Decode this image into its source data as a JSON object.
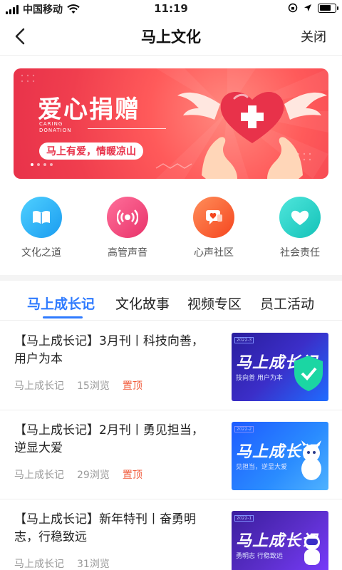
{
  "status_bar": {
    "carrier": "中国移动",
    "time": "11:19"
  },
  "nav": {
    "title": "马上文化",
    "close_label": "关闭"
  },
  "banner": {
    "title": "爱心捐赠",
    "subtitle_en_1": "CARING",
    "subtitle_en_2": "DONATION",
    "tagline": "马上有爱，情暖凉山",
    "colors": {
      "primary": "#f03e4e",
      "heart": "#e8324a"
    }
  },
  "quick_links": [
    {
      "label": "文化之道",
      "icon": "book-icon",
      "color": "#27b3f5"
    },
    {
      "label": "高管声音",
      "icon": "broadcast-icon",
      "color": "#f0457a"
    },
    {
      "label": "心声社区",
      "icon": "chat-heart-icon",
      "color": "#ff6a3d"
    },
    {
      "label": "社会责任",
      "icon": "heart-icon",
      "color": "#22d1c8"
    }
  ],
  "tabs": [
    {
      "label": "马上成长记",
      "active": true
    },
    {
      "label": "文化故事",
      "active": false
    },
    {
      "label": "视频专区",
      "active": false
    },
    {
      "label": "员工活动",
      "active": false
    }
  ],
  "articles": [
    {
      "title": "【马上成长记】3月刊丨科技向善，用户为本",
      "source": "马上成长记",
      "views": "15浏览",
      "badge": "置顶",
      "thumb_title": "马上成长记",
      "thumb_sub": "技向善 用户为本",
      "thumb_tag": "2022-3"
    },
    {
      "title": "【马上成长记】2月刊丨勇见担当，逆显大爱",
      "source": "马上成长记",
      "views": "29浏览",
      "badge": "置顶",
      "thumb_title": "马上成长记",
      "thumb_sub": "见担当，逆显大爱",
      "thumb_tag": "2022-2"
    },
    {
      "title": "【马上成长记】新年特刊丨奋勇明志，行稳致远",
      "source": "马上成长记",
      "views": "31浏览",
      "badge": "",
      "thumb_title": "马上成长记",
      "thumb_sub": "勇明志 行稳致远",
      "thumb_tag": "2022-1"
    }
  ],
  "accent_color": "#2f7bff"
}
